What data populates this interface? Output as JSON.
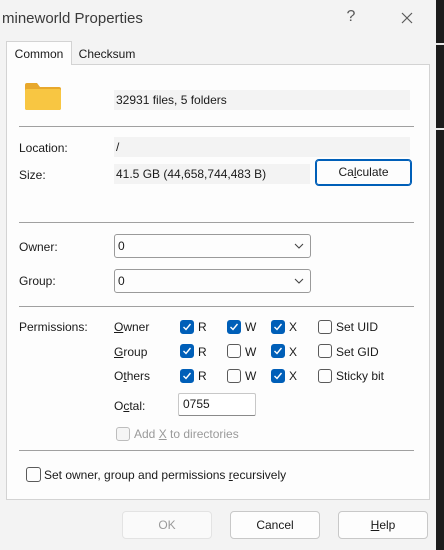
{
  "window": {
    "title": "mineworld Properties",
    "help_symbol": "?"
  },
  "tabs": [
    {
      "label": "Common",
      "active": true
    },
    {
      "label": "Checksum",
      "active": false
    }
  ],
  "summary": {
    "icon": "folder-icon",
    "text": "32931 files, 5 folders"
  },
  "location": {
    "label": "Location:",
    "value": "/"
  },
  "size": {
    "label": "Size:",
    "value": "41.5 GB (44,658,744,483 B)",
    "calculate_label": "Calculate"
  },
  "owner": {
    "label": "Owner:",
    "value": "0"
  },
  "group": {
    "label": "Group:",
    "value": "0"
  },
  "permissions": {
    "label": "Permissions:",
    "rows": [
      {
        "name": "Owner",
        "r": true,
        "w": true,
        "x": true,
        "extra_label": "Set UID",
        "extra": false
      },
      {
        "name": "Group",
        "r": true,
        "w": false,
        "x": true,
        "extra_label": "Set GID",
        "extra": false
      },
      {
        "name": "Others",
        "r": true,
        "w": false,
        "x": true,
        "extra_label": "Sticky bit",
        "extra": false
      }
    ],
    "r_label": "R",
    "w_label": "W",
    "x_label": "X",
    "octal_label": "Octal:",
    "octal_value": "0755",
    "add_x_label": "Add X to directories",
    "add_x_checked": false,
    "add_x_enabled": false
  },
  "recursive": {
    "label": "Set owner, group and permissions recursively",
    "checked": false
  },
  "buttons": {
    "ok": "OK",
    "cancel": "Cancel",
    "help": "Help"
  },
  "colors": {
    "accent": "#005fb8",
    "folder": "#f8c642"
  }
}
